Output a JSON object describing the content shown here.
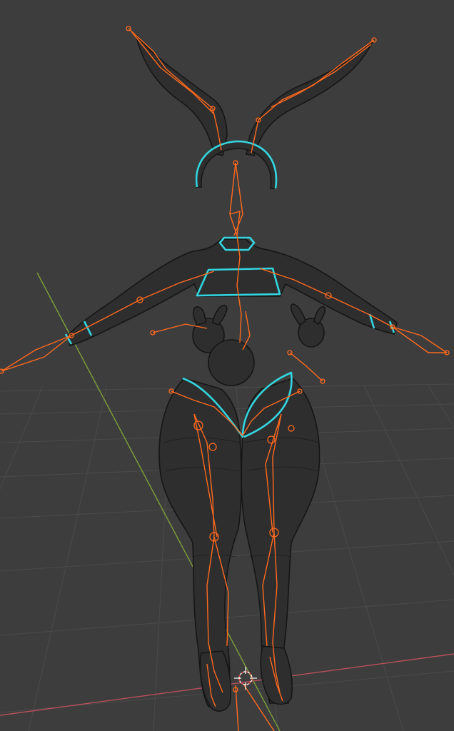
{
  "viewport": {
    "background": "#3d3d3d",
    "grid_color": "#4a4a4a",
    "x_axis_color": "#b8505a",
    "y_axis_color": "#7fa03a"
  },
  "scene": {
    "mesh_fill": "#2e2e2e",
    "wire_color": "#121212",
    "armature_color": "#ff6a1f",
    "selection_color": "#33d6e0"
  },
  "cursor": {
    "icon": "3d-cursor-icon"
  }
}
